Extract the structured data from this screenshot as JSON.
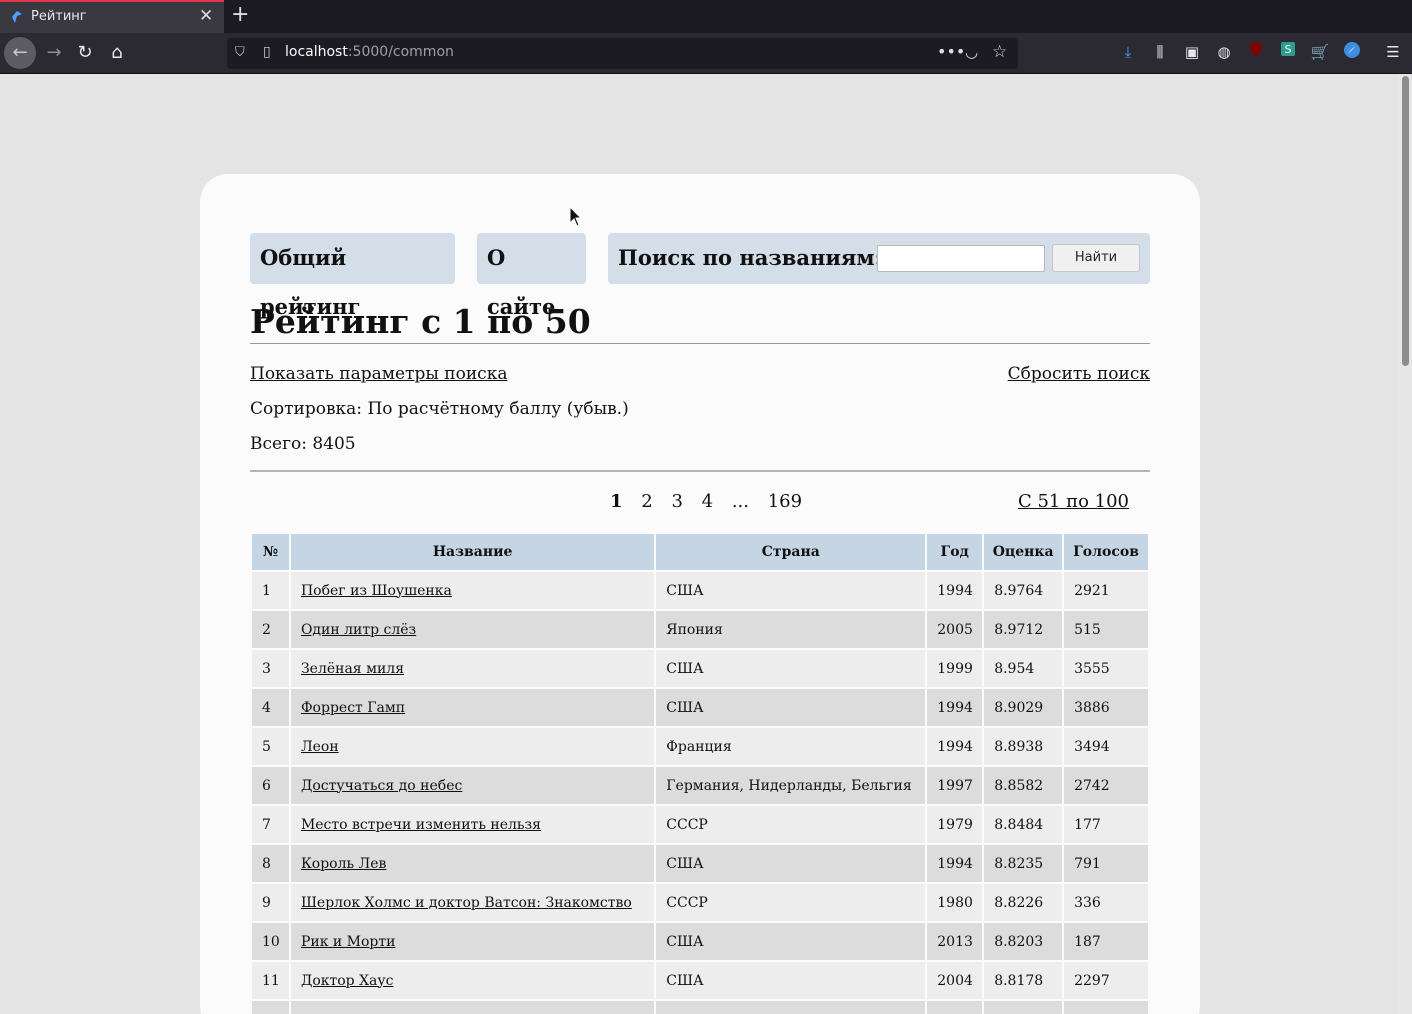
{
  "browser": {
    "tab_title": "Рейтинг",
    "tab_close": "✕",
    "new_tab": "+",
    "url_host": "localhost",
    "url_rest": ":5000/common",
    "icons": [
      "back-icon",
      "forward-icon",
      "reload-icon",
      "home-icon",
      "shield-icon",
      "page-icon",
      "more-icon",
      "pocket-icon",
      "star-icon",
      "download-icon",
      "library-icon",
      "sidebar-icon",
      "globe-icon",
      "ublock-icon",
      "s-extension-icon",
      "cart-icon",
      "compass-icon",
      "menu-icon"
    ]
  },
  "nav": {
    "overall_rating": "Общий рейтинг",
    "about": "О сайте",
    "search_label": "Поиск по названиям:",
    "search_placeholder": "",
    "search_button": "Найти"
  },
  "page": {
    "heading": "Рейтинг с 1 по 50",
    "show_params": "Показать параметры поиска",
    "reset_search": "Сбросить поиск",
    "sort_text": "Сортировка: По расчётному баллу (убыв.)",
    "total_text": "Всего: 8405"
  },
  "pagination": {
    "current": "1",
    "pages": [
      "2",
      "3",
      "4"
    ],
    "ellipsis": "...",
    "last": "169",
    "next_label": "С 51 по 100"
  },
  "table": {
    "headers": [
      "№",
      "Название",
      "Страна",
      "Год",
      "Оценка",
      "Голосов"
    ],
    "rows": [
      [
        "1",
        "Побег из Шоушенка",
        "США",
        "1994",
        "8.9764",
        "2921"
      ],
      [
        "2",
        "Один литр слёз",
        "Япония",
        "2005",
        "8.9712",
        "515"
      ],
      [
        "3",
        "Зелёная миля",
        "США",
        "1999",
        "8.954",
        "3555"
      ],
      [
        "4",
        "Форрест Гамп",
        "США",
        "1994",
        "8.9029",
        "3886"
      ],
      [
        "5",
        "Леон",
        "Франция",
        "1994",
        "8.8938",
        "3494"
      ],
      [
        "6",
        "Достучаться до небес",
        "Германия, Нидерланды, Бельгия",
        "1997",
        "8.8582",
        "2742"
      ],
      [
        "7",
        "Место встречи изменить нельзя",
        "СССР",
        "1979",
        "8.8484",
        "177"
      ],
      [
        "8",
        "Король Лев",
        "США",
        "1994",
        "8.8235",
        "791"
      ],
      [
        "9",
        "Шерлок Холмс и доктор Ватсон: Знакомство",
        "СССР",
        "1980",
        "8.8226",
        "336"
      ],
      [
        "10",
        "Рик и Морти",
        "США",
        "2013",
        "8.8203",
        "187"
      ],
      [
        "11",
        "Доктор Хаус",
        "США",
        "2004",
        "8.8178",
        "2297"
      ],
      [
        "",
        "",
        "",
        "",
        "",
        ""
      ]
    ]
  }
}
